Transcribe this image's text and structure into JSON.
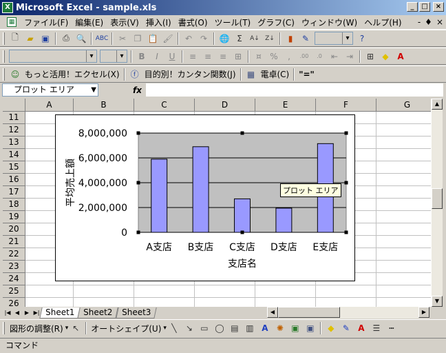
{
  "window": {
    "title": "Microsoft Excel - sample.xls",
    "app_icon_glyph": "X",
    "min_glyph": "_",
    "max_glyph": "□",
    "close_glyph": "×"
  },
  "menu": {
    "items": [
      "ファイル(F)",
      "編集(E)",
      "表示(V)",
      "挿入(I)",
      "書式(O)",
      "ツール(T)",
      "グラフ(C)",
      "ウィンドウ(W)",
      "ヘルプ(H)"
    ],
    "mdi_min": "-",
    "mdi_restore": "♦",
    "mdi_close": "×"
  },
  "toolbar3": {
    "item1": "もっと活用！エクセル(X)",
    "item2": "目的別！カンタン関数(J)",
    "item3": "電卓(C)",
    "item4": "\"=\""
  },
  "formula_bar": {
    "name_box": "プロット エリア",
    "fx_label": "fx",
    "value": ""
  },
  "grid": {
    "columns": [
      "A",
      "B",
      "C",
      "D",
      "E",
      "F",
      "G"
    ],
    "rows": [
      "11",
      "12",
      "13",
      "14",
      "15",
      "16",
      "17",
      "18",
      "19",
      "20",
      "21",
      "22",
      "23",
      "24",
      "25",
      "26"
    ]
  },
  "sheets": {
    "tabs": [
      "Sheet1",
      "Sheet2",
      "Sheet3"
    ],
    "active": "Sheet1"
  },
  "drawbar": {
    "adjust": "図形の調整(R)",
    "autoshape": "オートシェイプ(U)"
  },
  "status": {
    "text": "コマンド"
  },
  "tooltip": {
    "text": "プロット エリア"
  },
  "colors": {
    "bar_fill": "#9999ff",
    "plot_bg": "#c0c0c0",
    "titlebar_start": "#0a246a",
    "titlebar_end": "#a6caf0"
  },
  "chart_data": {
    "type": "bar",
    "categories": [
      "A支店",
      "B支店",
      "C支店",
      "D支店",
      "E支店"
    ],
    "values": [
      5900000,
      6900000,
      2700000,
      1950000,
      7150000
    ],
    "xlabel": "支店名",
    "ylabel": "平均売上額",
    "ylim": [
      0,
      8000000
    ],
    "yticks": [
      "0",
      "2,000,000",
      "4,000,000",
      "6,000,000",
      "8,000,000"
    ],
    "tick_values": [
      0,
      2000000,
      4000000,
      6000000,
      8000000
    ],
    "grid": true,
    "legend": "none"
  }
}
